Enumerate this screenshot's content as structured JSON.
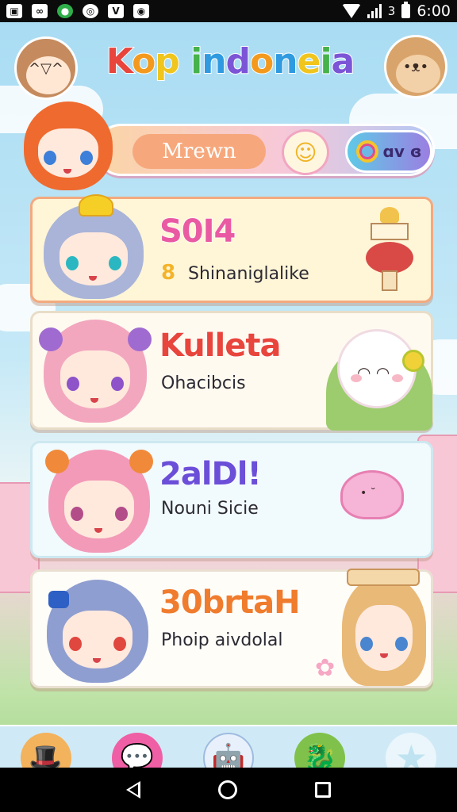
{
  "status_bar": {
    "left_icons": [
      "gallery-icon",
      "chat-icon",
      "spotify-icon",
      "app-icon",
      "vpn-icon",
      "camera-icon"
    ],
    "left_glyphs": [
      "▣",
      "∞",
      "●",
      "◎",
      "V",
      "◉"
    ],
    "sim_label": "3",
    "time": "6:00"
  },
  "header": {
    "title_parts": [
      "K",
      "o",
      "p",
      " ",
      "i",
      "n",
      "d",
      "o",
      "n",
      "e",
      "i",
      "a"
    ],
    "title": "Kop indoneia"
  },
  "menu_bar": {
    "label": "Mrewn",
    "pill_text": "ɑv ɞ",
    "cat_icon": "cat-face-icon"
  },
  "cards": [
    {
      "title": "S0I4",
      "subtitle": "Shinaniglalike",
      "number": "8",
      "title_color": "#e95aa3"
    },
    {
      "title": "Kulleta",
      "subtitle": "Ohacibcis"
    },
    {
      "title": "2alDl!",
      "subtitle": "Nouni Sicie"
    },
    {
      "title": "30brtaH",
      "subtitle": "Phoip aivdolal"
    }
  ],
  "bottom_bar": {
    "items": [
      {
        "icon": "hat-mascot-icon",
        "glyph": "🎩"
      },
      {
        "icon": "pink-chat-icon",
        "glyph": "💬"
      },
      {
        "icon": "robot-mascot-icon",
        "glyph": "🤖"
      },
      {
        "icon": "green-dragon-icon",
        "glyph": "🐉"
      },
      {
        "icon": "star-icon",
        "glyph": "★"
      }
    ]
  },
  "colors": {
    "accent_pink": "#e95aa3",
    "accent_orange": "#f6a87c",
    "sky": "#a9dcf3"
  }
}
